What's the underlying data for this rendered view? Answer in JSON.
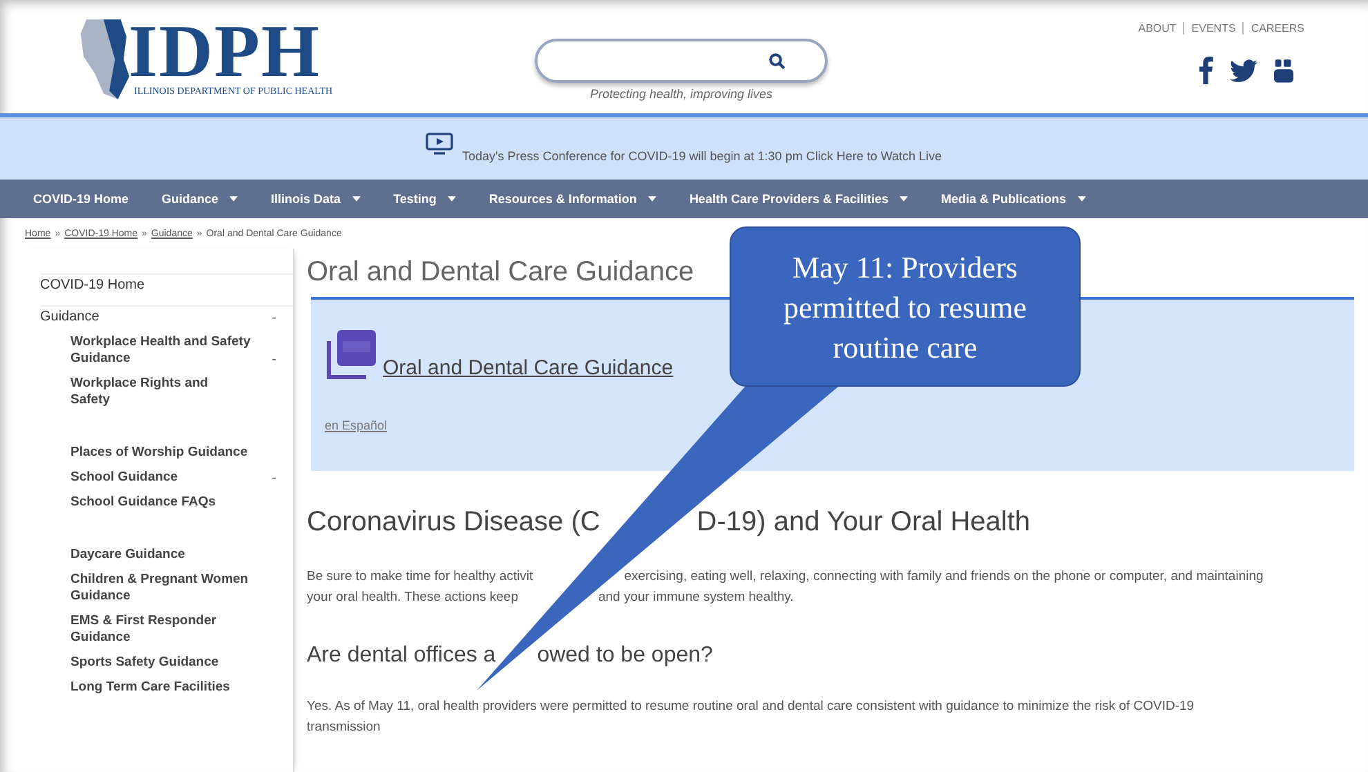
{
  "header": {
    "logo_text": "IDPH",
    "logo_subtitle": "ILLINOIS DEPARTMENT OF PUBLIC HEALTH",
    "tagline": "Protecting health, improving lives",
    "top_links": [
      "ABOUT",
      "EVENTS",
      "CAREERS"
    ]
  },
  "banner": {
    "text": "Today's Press Conference for COVID-19 will begin at 1:30 pm Click Here to Watch Live"
  },
  "nav": [
    {
      "label": "COVID-19 Home",
      "dropdown": false
    },
    {
      "label": "Guidance",
      "dropdown": true
    },
    {
      "label": "Illinois Data",
      "dropdown": true
    },
    {
      "label": "Testing",
      "dropdown": true
    },
    {
      "label": "Resources & Information",
      "dropdown": true
    },
    {
      "label": "Health Care Providers & Facilities",
      "dropdown": true
    },
    {
      "label": "Media & Publications",
      "dropdown": true
    }
  ],
  "breadcrumb": {
    "separator": "»",
    "items": [
      "Home",
      "COVID-19 Home",
      "Guidance",
      "Oral and Dental Care Guidance"
    ]
  },
  "sidebar": [
    {
      "label": "COVID-19 Home"
    },
    {
      "label": "Guidance",
      "toggle": "-",
      "children": [
        {
          "label": "Workplace Health and Safety Guidance",
          "toggle": "-",
          "children": [
            {
              "label": "Workplace Rights and Safety"
            }
          ]
        },
        {
          "label": "Places of Worship Guidance"
        },
        {
          "label": "School Guidance",
          "toggle": "-",
          "children": [
            {
              "label": "School Guidance FAQs"
            }
          ]
        },
        {
          "label": "Daycare Guidance"
        },
        {
          "label": "Children & Pregnant Women Guidance"
        },
        {
          "label": "EMS & First Responder Guidance"
        },
        {
          "label": "Sports Safety Guidance"
        },
        {
          "label": "Long Term Care Facilities"
        }
      ]
    }
  ],
  "page_title": "Oral and Dental Care Guidance",
  "document": {
    "link": "Oral and Dental Care Guidance",
    "alt_link": "en Español"
  },
  "body": [
    {
      "kind": "heading",
      "lines": [
        [
          "Coronavirus Disease (C",
          "D-19) and Your Oral Health"
        ]
      ]
    },
    {
      "kind": "paragraph",
      "lines": [
        [
          "Be sure to make time for healthy activit",
          "exercising, eating well, relaxing, connecting with family and friends on the phone or computer, and maintaining"
        ],
        [
          "your oral health. These actions keep",
          "and your immune system healthy."
        ]
      ]
    },
    {
      "kind": "subheading",
      "lines": [
        [
          "Are dental offices a",
          "owed to be open?"
        ]
      ]
    },
    {
      "kind": "paragraph",
      "lines": [
        [
          "Yes.  As of May 11, oral health providers were permitted to resume routine oral and dental care consistent with guidance to minimize the risk of COVID-19"
        ],
        [
          "transmission"
        ]
      ]
    }
  ],
  "callout": {
    "text": "May 11: Providers permitted to resume routine care"
  }
}
